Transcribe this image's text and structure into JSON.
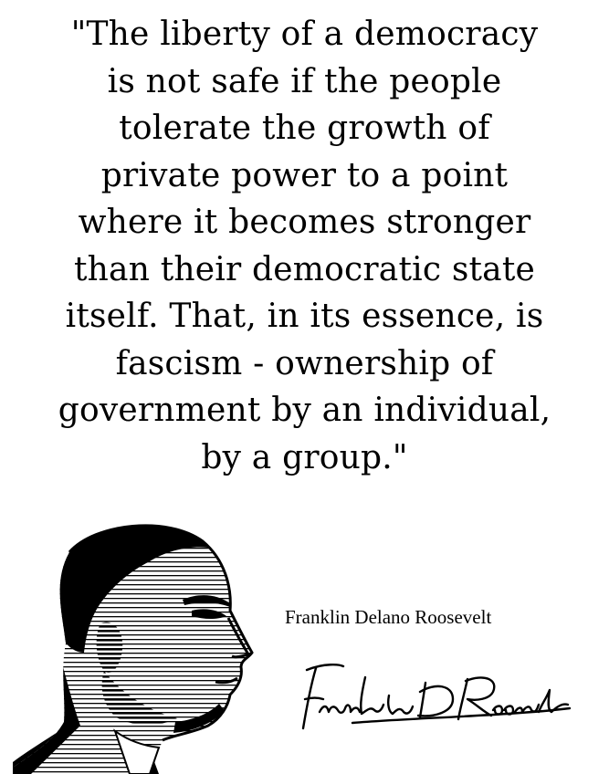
{
  "quote": {
    "lines": [
      "\"The liberty of a democracy",
      "is not safe if the people",
      "tolerate the growth of",
      "private power to a point",
      "where it becomes stronger",
      "than their democratic state",
      "itself. That, in its essence, is",
      "fascism - ownership of",
      "government by an individual,",
      "by a group.\""
    ]
  },
  "attribution": {
    "name": "Franklin Delano Roosevelt"
  },
  "signature": {
    "text": "Franklin D Roosevelt"
  },
  "colors": {
    "background": "#ffffff",
    "text": "#000000"
  },
  "icons": {
    "portrait": "portrait-illustration",
    "signature": "handwritten-signature"
  }
}
